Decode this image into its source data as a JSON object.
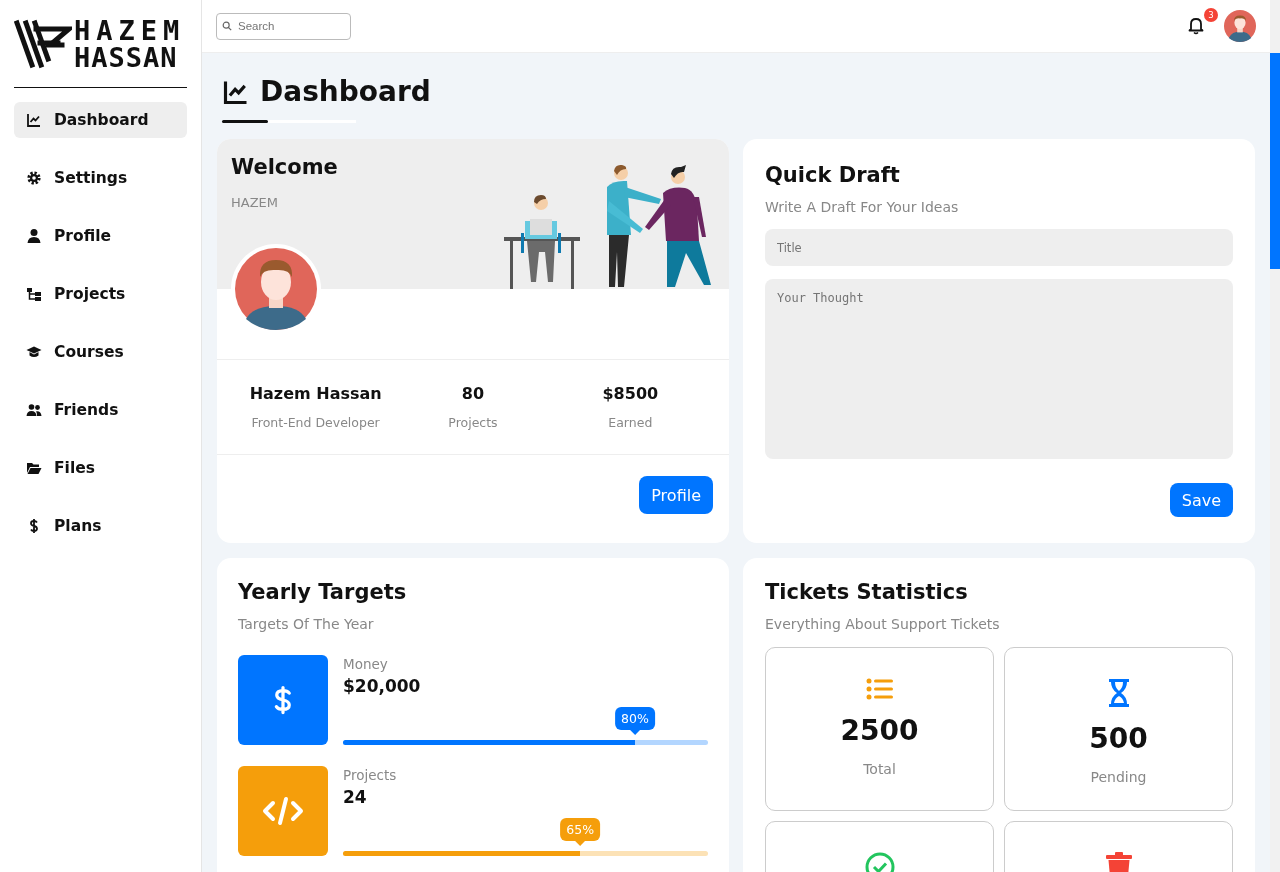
{
  "brand": {
    "line_1": "HAZEM",
    "line_2": "HASSAN"
  },
  "sidebar": {
    "items": [
      {
        "label": "Dashboard",
        "selected": true
      },
      {
        "label": "Settings",
        "selected": false
      },
      {
        "label": "Profile",
        "selected": false
      },
      {
        "label": "Projects",
        "selected": false
      },
      {
        "label": "Courses",
        "selected": false
      },
      {
        "label": "Friends",
        "selected": false
      },
      {
        "label": "Files",
        "selected": false
      },
      {
        "label": "Plans",
        "selected": false
      }
    ]
  },
  "header": {
    "search": {
      "placeholder": "Search"
    },
    "notifications": {
      "count": "3"
    }
  },
  "page_title": "Dashboard",
  "welcome": {
    "title": "Welcome",
    "user": "HAZEM",
    "stats": [
      {
        "value": "Hazem Hassan",
        "label": "Front-End Developer"
      },
      {
        "value": "80",
        "label": "Projects"
      },
      {
        "value": "$8500",
        "label": "Earned"
      }
    ],
    "button": "Profile"
  },
  "quick_draft": {
    "title": "Quick Draft",
    "subtitle": "Write A Draft For Your Ideas",
    "title_field": {
      "placeholder": "Title"
    },
    "thought_field": {
      "placeholder": "Your Thought"
    },
    "button": "Save"
  },
  "yearly_targets": {
    "title": "Yearly Targets",
    "subtitle": "Targets Of The Year",
    "targets": [
      {
        "kind": "money",
        "label": "Money",
        "value": "$20,000",
        "level": 0.8,
        "reading": "80%",
        "color": "#0075ff"
      },
      {
        "kind": "code",
        "label": "Projects",
        "value": "24",
        "level": 0.65,
        "reading": "65%",
        "color": "#f59e0b"
      }
    ]
  },
  "tickets": {
    "title": "Tickets Statistics",
    "subtitle": "Everything About Support Tickets",
    "stats": [
      {
        "kind": "total",
        "value": "2500",
        "label": "Total"
      },
      {
        "kind": "pending",
        "value": "500",
        "label": "Pending"
      },
      {
        "kind": "closed"
      },
      {
        "kind": "deleted"
      }
    ]
  }
}
